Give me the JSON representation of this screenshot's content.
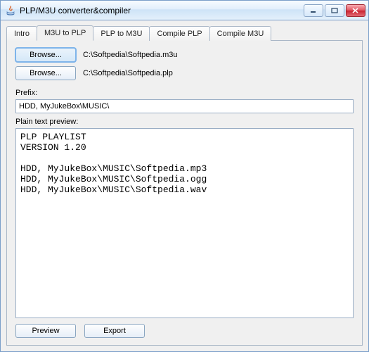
{
  "window": {
    "title": "PLP/M3U converter&compiler"
  },
  "tabs": {
    "items": [
      {
        "label": "Intro"
      },
      {
        "label": "M3U to PLP"
      },
      {
        "label": "PLP to M3U"
      },
      {
        "label": "Compile PLP"
      },
      {
        "label": "Compile M3U"
      }
    ],
    "activeIndex": 1
  },
  "panel": {
    "browse1_label": "Browse...",
    "path1": "C:\\Softpedia\\Softpedia.m3u",
    "browse2_label": "Browse...",
    "path2": "C:\\Softpedia\\Softpedia.plp",
    "prefix_label": "Prefix:",
    "prefix_value": "HDD, MyJukeBox\\MUSIC\\",
    "preview_label": "Plain text preview:",
    "preview_text": "PLP PLAYLIST\nVERSION 1.20\n\nHDD, MyJukeBox\\MUSIC\\Softpedia.mp3\nHDD, MyJukeBox\\MUSIC\\Softpedia.ogg\nHDD, MyJukeBox\\MUSIC\\Softpedia.wav"
  },
  "buttons": {
    "preview": "Preview",
    "export": "Export"
  }
}
